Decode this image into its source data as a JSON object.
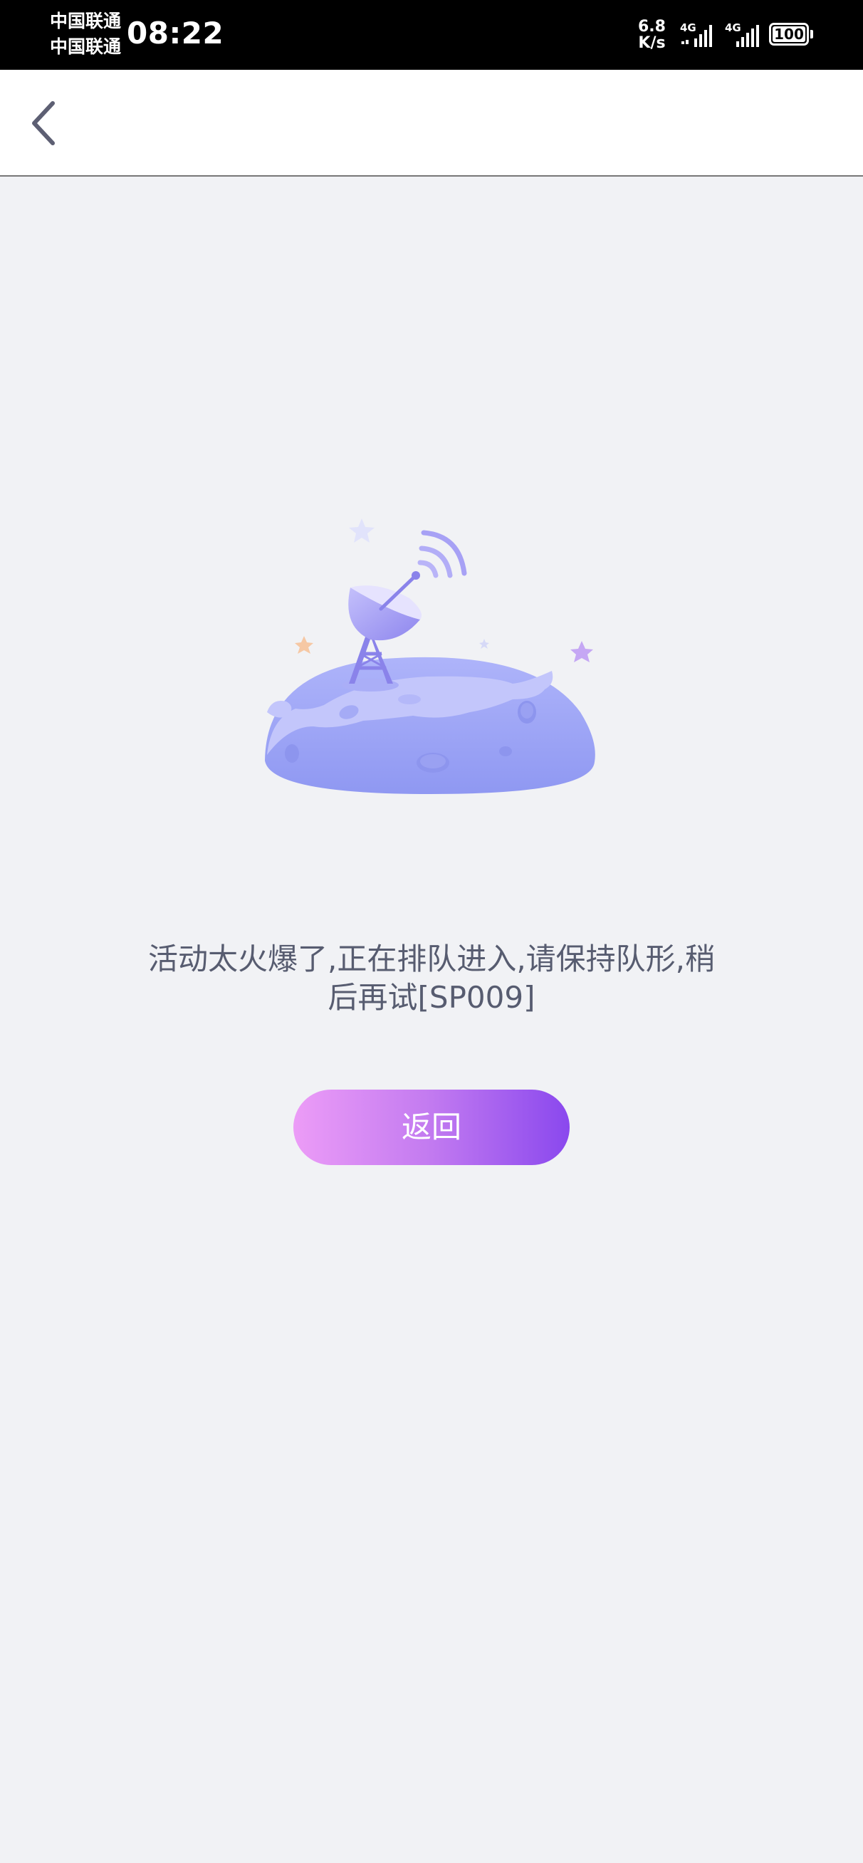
{
  "status_bar": {
    "carrier_1": "中国联通",
    "carrier_2": "中国联通",
    "time": "08:22",
    "net_speed_value": "6.8",
    "net_speed_unit": "K/s",
    "signal_1_label": "4G",
    "signal_2_label": "4G",
    "battery_level": "100"
  },
  "nav": {
    "back_icon": "chevron-left-icon"
  },
  "main": {
    "illustration": "satellite-dish-planet-illustration",
    "message": "活动太火爆了,正在排队进入,请保持队形,稍后再试[SP009]",
    "return_button": "返回"
  },
  "colors": {
    "background": "#f1f2f5",
    "text": "#575c70",
    "button_gradient_start": "#ec9cf7",
    "button_gradient_end": "#8a48ee",
    "illustration_primary": "#9ea5f7"
  }
}
